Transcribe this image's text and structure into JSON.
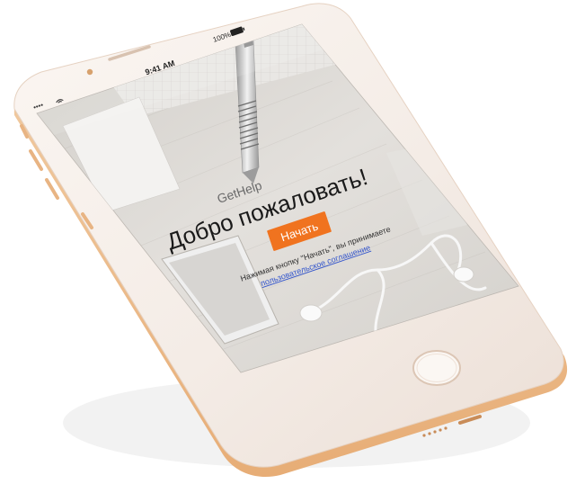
{
  "status_bar": {
    "signal": "••••",
    "time": "9:41 AM",
    "battery": "100%"
  },
  "app": {
    "name": "GetHelp",
    "welcome_title": "Добро пожаловать!",
    "start_button": "Начать",
    "terms_prefix": "Нажимая кнопку \"Начать\", вы принимаете",
    "terms_link": "пользовательское соглашение"
  },
  "colors": {
    "accent": "#f0731f",
    "link": "#3355cc",
    "frame": "#f6eee8",
    "frame_edge": "#e9b987",
    "screen_bg": "#d9d6d1"
  },
  "icons": {
    "signal": "signal-bars-icon",
    "wifi": "wifi-icon",
    "battery": "battery-icon",
    "home": "home-button-icon",
    "camera": "front-camera-icon",
    "speaker": "earpiece-speaker-icon"
  }
}
